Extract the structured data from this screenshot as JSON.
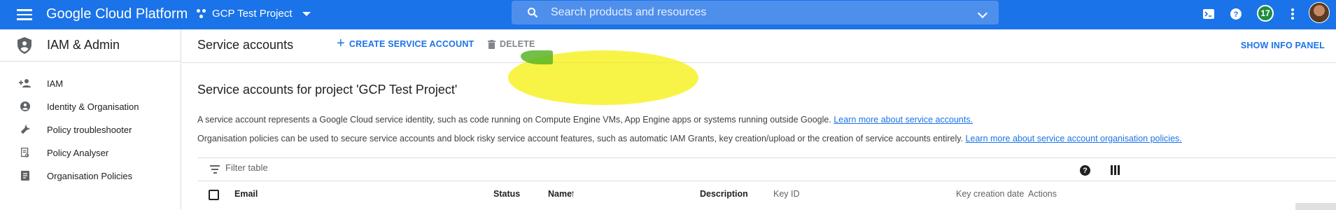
{
  "topbar": {
    "brand": "Google Cloud Platform",
    "project": "GCP Test Project",
    "search_placeholder": "Search products and resources",
    "notifications_count": "17"
  },
  "sidebar": {
    "title": "IAM & Admin",
    "items": [
      {
        "label": "IAM",
        "icon": "person-add-icon"
      },
      {
        "label": "Identity & Organisation",
        "icon": "account-circle-icon"
      },
      {
        "label": "Policy troubleshooter",
        "icon": "wrench-icon"
      },
      {
        "label": "Policy Analyser",
        "icon": "document-search-icon"
      },
      {
        "label": "Organisation Policies",
        "icon": "list-document-icon"
      }
    ]
  },
  "header": {
    "title": "Service accounts",
    "create_label": "CREATE SERVICE ACCOUNT",
    "delete_label": "DELETE",
    "info_panel_label": "SHOW INFO PANEL"
  },
  "content": {
    "section_title": "Service accounts for project 'GCP Test Project'",
    "desc1": "A service account represents a Google Cloud service identity, such as code running on Compute Engine VMs, App Engine apps or systems running outside Google.",
    "desc1_link": "Learn more about service accounts.",
    "desc2": "Organisation policies can be used to secure service accounts and block risky service account features, such as automatic IAM Grants, key creation/upload or the creation of service accounts entirely.",
    "desc2_link": "Learn more about service account organisation policies."
  },
  "table": {
    "filter_placeholder": "Filter table",
    "columns": {
      "email": "Email",
      "status": "Status",
      "name": "Name",
      "description": "Description",
      "key_id": "Key ID",
      "key_creation_date": "Key creation date",
      "actions": "Actions"
    },
    "sort_indicator": "↑"
  },
  "colors": {
    "topbar": "#1a73e8",
    "link": "#1a73e8",
    "highlight": "#f5f000"
  }
}
